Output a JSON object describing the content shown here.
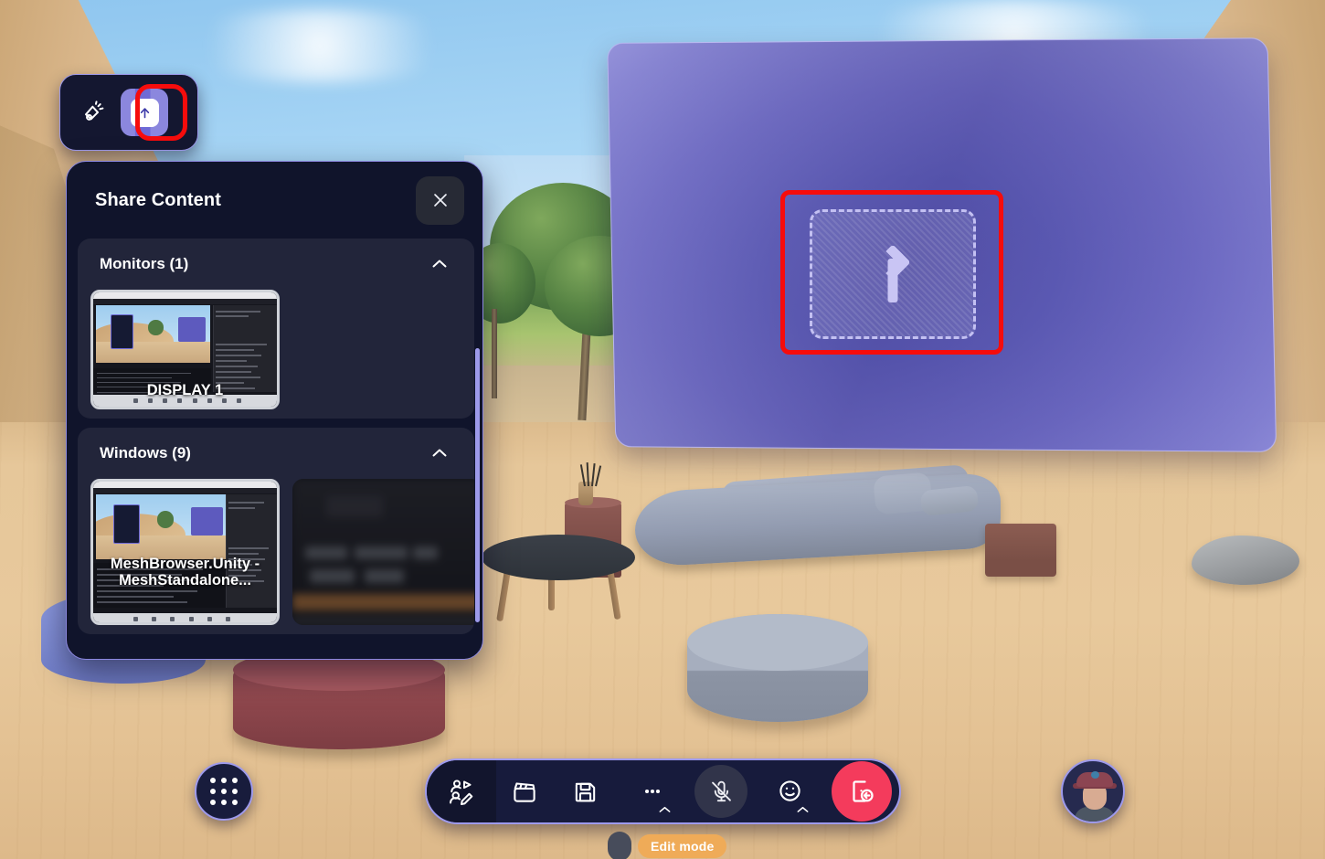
{
  "mini_toolbar": {
    "buttons": [
      {
        "name": "reactions-icon",
        "label": "Reactions",
        "active": false
      },
      {
        "name": "share-content-icon",
        "label": "Share content",
        "active": true
      }
    ]
  },
  "share_panel": {
    "title": "Share Content",
    "close_label": "Close",
    "sections": [
      {
        "id": "monitors",
        "title": "Monitors (1)",
        "count": 1,
        "collapse_icon": "chevron-up-icon",
        "items": [
          {
            "label": "DISPLAY 1",
            "kind": "monitor"
          }
        ]
      },
      {
        "id": "windows",
        "title": "Windows (9)",
        "count": 9,
        "collapse_icon": "chevron-up-icon",
        "items": [
          {
            "label": "MeshBrowser.Unity - MeshStandalone...",
            "kind": "window"
          },
          {
            "label": "",
            "kind": "window-blurred"
          }
        ]
      }
    ]
  },
  "big_screen": {
    "drop_hint_icon": "upload-arrow-icon",
    "highlighted": true
  },
  "bottom_bar": {
    "items": [
      {
        "name": "people-edit-icon",
        "label": "Participants",
        "style": "dark",
        "has_caret": false
      },
      {
        "name": "clapperboard-icon",
        "label": "Record",
        "style": "plain",
        "has_caret": false
      },
      {
        "name": "save-icon",
        "label": "Save",
        "style": "plain",
        "has_caret": false
      },
      {
        "name": "more-icon",
        "label": "More",
        "style": "plain",
        "has_caret": true
      },
      {
        "name": "microphone-muted-icon",
        "label": "Unmute",
        "style": "circle-grey",
        "has_caret": false
      },
      {
        "name": "emoji-icon",
        "label": "Reactions",
        "style": "plain",
        "has_caret": true
      },
      {
        "name": "leave-icon",
        "label": "Leave",
        "style": "circle-red",
        "has_caret": false
      }
    ]
  },
  "grid_button": {
    "name": "app-grid-icon",
    "label": "Apps"
  },
  "edit_mode": {
    "label": "Edit mode",
    "enabled": true
  },
  "avatar": {
    "label": "My avatar"
  },
  "colors": {
    "panel_bg": "#10142b",
    "panel_border": "#8c88e0",
    "section_bg": "#22253a",
    "accent_purple": "#6e6ad6",
    "highlight_red": "#f60c0c",
    "leave_red": "#f43b5c",
    "edit_mode_orange": "#efab58",
    "scrollbar": "#9d9aea"
  }
}
